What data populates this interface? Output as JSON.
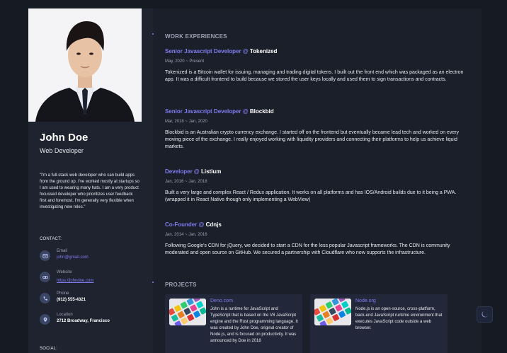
{
  "profile": {
    "name": "John Doe",
    "title": "Web Developer",
    "quote": "\"I'm a full-stack web developer who can build apps from the ground up. I've worked mostly at startups so I am used to wearing many hats. I am a very product focussed developer who prioritizes user feedback first and foremost. I'm generally very flexible when investigating new roles.\""
  },
  "contact": {
    "heading": "CONTACT:",
    "email": {
      "label": "Email",
      "value": "john@gmail.com",
      "icon": "mail-icon"
    },
    "website": {
      "label": "Website",
      "value": "https://johndoe.com",
      "icon": "link-icon"
    },
    "phone": {
      "label": "Phone",
      "value": "(912) 555-4321",
      "icon": "phone-icon"
    },
    "location": {
      "label": "Location",
      "value": "2712 Broadway, Francisco",
      "icon": "location-icon"
    }
  },
  "social": {
    "heading": "SOCIAL:"
  },
  "experience": {
    "heading": "WORK EXPERIENCES",
    "jobs": [
      {
        "role": "Senior Javascript Developer @",
        "company": "Tokenized",
        "dates": "May, 2020 ~ Present",
        "description": "Tokenized is a Bitcoin wallet for issuing, managing and trading digital tokens. I built out the front end which was packaged as an electron app. It was a difficult frontend to build because we stored the user keys locally and used them to sign transactions and contracts."
      },
      {
        "role": "Senior Javascript Developer @",
        "company": "Blockbid",
        "dates": "Mar, 2018 ~ Jan, 2020",
        "description": "Blockbid is an Australian crypto currency exchange. I started off on the frontend but eventually became lead tech and worked on every moving piece of the exchange. I really enjoyed working with liquidity providers and connecting their platforms to help us achieve liquid markets."
      },
      {
        "role": "Developer @",
        "company": "Listium",
        "dates": "Jan, 2016 ~ Jan, 2018",
        "description": "Built a very large and complex React / Redux application. It works on all platforms and has IOS/Android builds due to it being a PWA. (wrapped it in React Native though only implementing a WebView)"
      },
      {
        "role": "Co-Founder @",
        "company": "Cdnjs",
        "dates": "Jan, 2014 ~ Jan, 2016",
        "description": "Following Google's CDN for jQuery, we decided to start a CDN for the less popular Javascript frameworks. The CDN is community moderated and open source on GitHub. We secured a partnership with Cloudflare who now supports the infrastructure."
      }
    ]
  },
  "projects": {
    "heading": "PROJECTS",
    "items": [
      {
        "name": "Deno.com",
        "description": "John is a runtime for JavaScript and TypeScript that is based on the V8 JavaScript engine and the Rust programming language. It was created by John Doe, original creator of Node.js, and is focused on productivity. It was announced by Doe in 2018"
      },
      {
        "name": "Node.org",
        "description": "Node.js is an open-source, cross-platform, back-end JavaScript runtime environment that executes JavaScript code outside a web browser."
      }
    ]
  },
  "theme_toggle": {
    "icon": "moon-icon"
  },
  "colors": {
    "accent": "#7f7cf0",
    "background": "#161a23",
    "card": "#1b1f2a",
    "sidebar": "#1f2330"
  }
}
